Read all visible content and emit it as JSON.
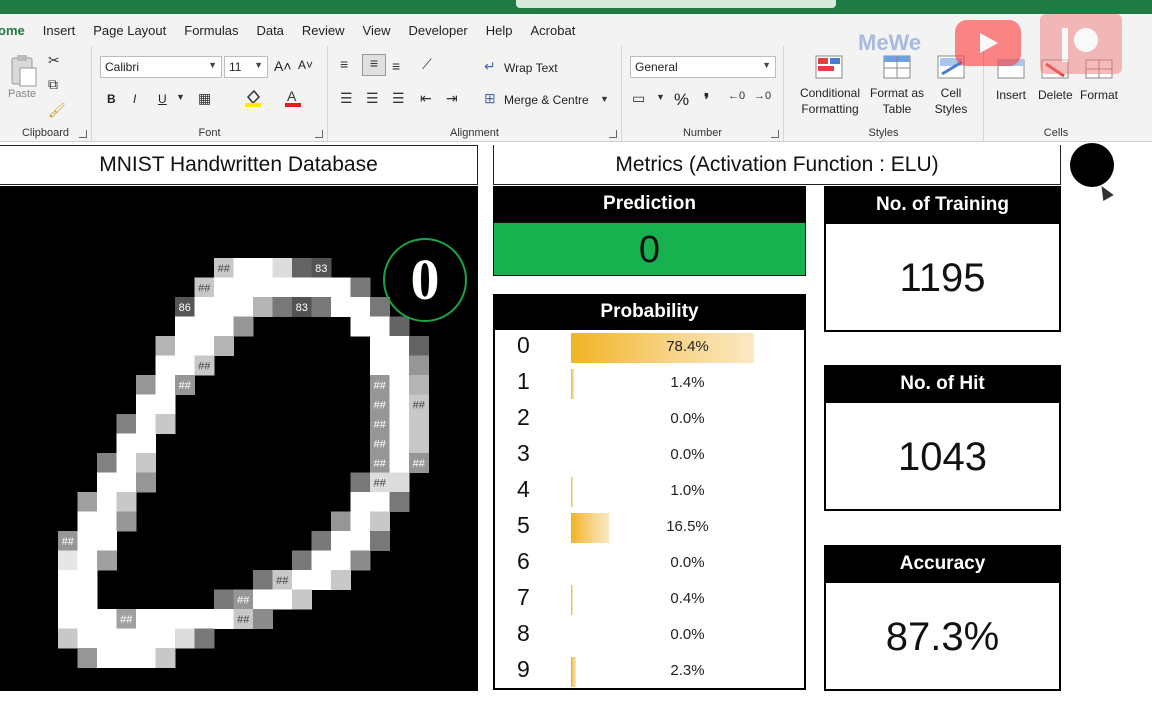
{
  "menu": {
    "tabs": [
      "ome",
      "Insert",
      "Page Layout",
      "Formulas",
      "Data",
      "Review",
      "View",
      "Developer",
      "Help",
      "Acrobat"
    ]
  },
  "watermarks": {
    "mewe": "MeWe"
  },
  "ribbon": {
    "clipboard": {
      "label": "Clipboard",
      "paste": "Paste"
    },
    "font": {
      "label": "Font",
      "name": "Calibri",
      "size": "11",
      "bold": "B",
      "italic": "I",
      "underline": "U",
      "grow": "A˄",
      "shrink": "A˅"
    },
    "alignment": {
      "label": "Alignment",
      "wrap": "Wrap Text",
      "merge": "Merge & Centre"
    },
    "number": {
      "label": "Number",
      "format": "General",
      "percent": "%",
      "comma": "❜"
    },
    "styles": {
      "label": "Styles",
      "conditional": "Conditional",
      "conditional2": "Formatting",
      "format_table": "Format as",
      "format_table2": "Table",
      "cell_styles": "Cell",
      "cell_styles2": "Styles"
    },
    "cells": {
      "label": "Cells",
      "insert": "Insert",
      "delete": "Delete",
      "format": "Format"
    }
  },
  "dashboard": {
    "mnist_title": "MNIST Handwritten Database",
    "predicted_digit_badge": "0",
    "metrics_title": "Metrics (Activation Function : ELU)",
    "prediction_label": "Prediction",
    "prediction_value": "0",
    "probability_label": "Probability",
    "probabilities": [
      {
        "digit": "0",
        "pct": "78.4%",
        "value": 0.784
      },
      {
        "digit": "1",
        "pct": "1.4%",
        "value": 0.014
      },
      {
        "digit": "2",
        "pct": "0.0%",
        "value": 0.0
      },
      {
        "digit": "3",
        "pct": "0.0%",
        "value": 0.0
      },
      {
        "digit": "4",
        "pct": "1.0%",
        "value": 0.01
      },
      {
        "digit": "5",
        "pct": "16.5%",
        "value": 0.165
      },
      {
        "digit": "6",
        "pct": "0.0%",
        "value": 0.0
      },
      {
        "digit": "7",
        "pct": "0.4%",
        "value": 0.004
      },
      {
        "digit": "8",
        "pct": "0.0%",
        "value": 0.0
      },
      {
        "digit": "9",
        "pct": "2.3%",
        "value": 0.023
      }
    ],
    "training_label": "No. of Training",
    "training_value": "1195",
    "hit_label": "No. of Hit",
    "hit_value": "1043",
    "accuracy_label": "Accuracy",
    "accuracy_value": "87.3%"
  },
  "mnist_cells": [
    {
      "r": 0,
      "c": 8,
      "v": 200,
      "t": "##"
    },
    {
      "r": 0,
      "c": 9,
      "v": 255
    },
    {
      "r": 0,
      "c": 10,
      "v": 255
    },
    {
      "r": 0,
      "c": 11,
      "v": 220
    },
    {
      "r": 0,
      "c": 12,
      "v": 100
    },
    {
      "r": 0,
      "c": 13,
      "v": 83,
      "t": "83"
    },
    {
      "r": 1,
      "c": 7,
      "v": 200,
      "t": "##"
    },
    {
      "r": 1,
      "c": 8,
      "v": 255
    },
    {
      "r": 1,
      "c": 9,
      "v": 255
    },
    {
      "r": 1,
      "c": 10,
      "v": 255
    },
    {
      "r": 1,
      "c": 11,
      "v": 255
    },
    {
      "r": 1,
      "c": 12,
      "v": 255
    },
    {
      "r": 1,
      "c": 13,
      "v": 255
    },
    {
      "r": 1,
      "c": 14,
      "v": 255
    },
    {
      "r": 1,
      "c": 15,
      "v": 120
    },
    {
      "r": 2,
      "c": 6,
      "v": 86,
      "t": "86"
    },
    {
      "r": 2,
      "c": 7,
      "v": 255
    },
    {
      "r": 2,
      "c": 8,
      "v": 255
    },
    {
      "r": 2,
      "c": 9,
      "v": 255
    },
    {
      "r": 2,
      "c": 10,
      "v": 180
    },
    {
      "r": 2,
      "c": 11,
      "v": 120
    },
    {
      "r": 2,
      "c": 12,
      "v": 83,
      "t": "83"
    },
    {
      "r": 2,
      "c": 13,
      "v": 120
    },
    {
      "r": 2,
      "c": 14,
      "v": 255
    },
    {
      "r": 2,
      "c": 15,
      "v": 255
    },
    {
      "r": 2,
      "c": 16,
      "v": 120
    },
    {
      "r": 3,
      "c": 6,
      "v": 255
    },
    {
      "r": 3,
      "c": 7,
      "v": 255
    },
    {
      "r": 3,
      "c": 8,
      "v": 255
    },
    {
      "r": 3,
      "c": 9,
      "v": 150
    },
    {
      "r": 3,
      "c": 15,
      "v": 255
    },
    {
      "r": 3,
      "c": 16,
      "v": 255
    },
    {
      "r": 3,
      "c": 17,
      "v": 100
    },
    {
      "r": 4,
      "c": 5,
      "v": 180
    },
    {
      "r": 4,
      "c": 6,
      "v": 255
    },
    {
      "r": 4,
      "c": 7,
      "v": 255
    },
    {
      "r": 4,
      "c": 8,
      "v": 180
    },
    {
      "r": 4,
      "c": 16,
      "v": 255
    },
    {
      "r": 4,
      "c": 17,
      "v": 255
    },
    {
      "r": 4,
      "c": 18,
      "v": 100
    },
    {
      "r": 5,
      "c": 5,
      "v": 255
    },
    {
      "r": 5,
      "c": 6,
      "v": 255
    },
    {
      "r": 5,
      "c": 7,
      "v": 200,
      "t": "##"
    },
    {
      "r": 5,
      "c": 16,
      "v": 255
    },
    {
      "r": 5,
      "c": 17,
      "v": 255
    },
    {
      "r": 5,
      "c": 18,
      "v": 150
    },
    {
      "r": 6,
      "c": 4,
      "v": 150
    },
    {
      "r": 6,
      "c": 5,
      "v": 255
    },
    {
      "r": 6,
      "c": 6,
      "v": 150,
      "t": "##"
    },
    {
      "r": 6,
      "c": 16,
      "v": 150,
      "t": "##"
    },
    {
      "r": 6,
      "c": 17,
      "v": 255
    },
    {
      "r": 6,
      "c": 18,
      "v": 180
    },
    {
      "r": 7,
      "c": 4,
      "v": 255
    },
    {
      "r": 7,
      "c": 5,
      "v": 255
    },
    {
      "r": 7,
      "c": 16,
      "v": 150,
      "t": "##"
    },
    {
      "r": 7,
      "c": 17,
      "v": 255
    },
    {
      "r": 7,
      "c": 18,
      "v": 200,
      "t": "##"
    },
    {
      "r": 8,
      "c": 3,
      "v": 130
    },
    {
      "r": 8,
      "c": 4,
      "v": 255
    },
    {
      "r": 8,
      "c": 5,
      "v": 200
    },
    {
      "r": 8,
      "c": 16,
      "v": 150,
      "t": "##"
    },
    {
      "r": 8,
      "c": 17,
      "v": 255
    },
    {
      "r": 8,
      "c": 18,
      "v": 200
    },
    {
      "r": 9,
      "c": 3,
      "v": 255
    },
    {
      "r": 9,
      "c": 4,
      "v": 255
    },
    {
      "r": 9,
      "c": 16,
      "v": 150,
      "t": "##"
    },
    {
      "r": 9,
      "c": 17,
      "v": 255
    },
    {
      "r": 9,
      "c": 18,
      "v": 200
    },
    {
      "r": 10,
      "c": 2,
      "v": 130
    },
    {
      "r": 10,
      "c": 3,
      "v": 255
    },
    {
      "r": 10,
      "c": 4,
      "v": 200
    },
    {
      "r": 10,
      "c": 16,
      "v": 150,
      "t": "##"
    },
    {
      "r": 10,
      "c": 17,
      "v": 255
    },
    {
      "r": 10,
      "c": 18,
      "v": 150,
      "t": "##"
    },
    {
      "r": 11,
      "c": 2,
      "v": 255
    },
    {
      "r": 11,
      "c": 3,
      "v": 255
    },
    {
      "r": 11,
      "c": 4,
      "v": 150
    },
    {
      "r": 11,
      "c": 15,
      "v": 120
    },
    {
      "r": 11,
      "c": 16,
      "v": 220,
      "t": "##"
    },
    {
      "r": 11,
      "c": 17,
      "v": 220
    },
    {
      "r": 12,
      "c": 1,
      "v": 160
    },
    {
      "r": 12,
      "c": 2,
      "v": 255
    },
    {
      "r": 12,
      "c": 3,
      "v": 200
    },
    {
      "r": 12,
      "c": 15,
      "v": 255
    },
    {
      "r": 12,
      "c": 16,
      "v": 255
    },
    {
      "r": 12,
      "c": 17,
      "v": 120
    },
    {
      "r": 13,
      "c": 1,
      "v": 255
    },
    {
      "r": 13,
      "c": 2,
      "v": 255
    },
    {
      "r": 13,
      "c": 3,
      "v": 150
    },
    {
      "r": 13,
      "c": 14,
      "v": 150
    },
    {
      "r": 13,
      "c": 15,
      "v": 255
    },
    {
      "r": 13,
      "c": 16,
      "v": 200
    },
    {
      "r": 14,
      "c": 0,
      "v": 150,
      "t": "##"
    },
    {
      "r": 14,
      "c": 1,
      "v": 255
    },
    {
      "r": 14,
      "c": 2,
      "v": 255
    },
    {
      "r": 14,
      "c": 13,
      "v": 120
    },
    {
      "r": 14,
      "c": 14,
      "v": 255
    },
    {
      "r": 14,
      "c": 15,
      "v": 255
    },
    {
      "r": 14,
      "c": 16,
      "v": 120
    },
    {
      "r": 15,
      "c": 0,
      "v": 230
    },
    {
      "r": 15,
      "c": 1,
      "v": 255
    },
    {
      "r": 15,
      "c": 2,
      "v": 160
    },
    {
      "r": 15,
      "c": 12,
      "v": 120
    },
    {
      "r": 15,
      "c": 13,
      "v": 255
    },
    {
      "r": 15,
      "c": 14,
      "v": 255
    },
    {
      "r": 15,
      "c": 15,
      "v": 140
    },
    {
      "r": 16,
      "c": 0,
      "v": 255
    },
    {
      "r": 16,
      "c": 1,
      "v": 255
    },
    {
      "r": 16,
      "c": 10,
      "v": 120
    },
    {
      "r": 16,
      "c": 11,
      "v": 200,
      "t": "##"
    },
    {
      "r": 16,
      "c": 12,
      "v": 255
    },
    {
      "r": 16,
      "c": 13,
      "v": 255
    },
    {
      "r": 16,
      "c": 14,
      "v": 200
    },
    {
      "r": 17,
      "c": 0,
      "v": 255
    },
    {
      "r": 17,
      "c": 1,
      "v": 255
    },
    {
      "r": 17,
      "c": 8,
      "v": 120
    },
    {
      "r": 17,
      "c": 9,
      "v": 150,
      "t": "##"
    },
    {
      "r": 17,
      "c": 10,
      "v": 255
    },
    {
      "r": 17,
      "c": 11,
      "v": 255
    },
    {
      "r": 17,
      "c": 12,
      "v": 200
    },
    {
      "r": 18,
      "c": 0,
      "v": 255
    },
    {
      "r": 18,
      "c": 1,
      "v": 255
    },
    {
      "r": 18,
      "c": 2,
      "v": 255
    },
    {
      "r": 18,
      "c": 3,
      "v": 160,
      "t": "##"
    },
    {
      "r": 18,
      "c": 4,
      "v": 255
    },
    {
      "r": 18,
      "c": 5,
      "v": 255
    },
    {
      "r": 18,
      "c": 6,
      "v": 255
    },
    {
      "r": 18,
      "c": 7,
      "v": 255
    },
    {
      "r": 18,
      "c": 8,
      "v": 255
    },
    {
      "r": 18,
      "c": 9,
      "v": 200,
      "t": "##"
    },
    {
      "r": 18,
      "c": 10,
      "v": 140
    },
    {
      "r": 19,
      "c": 0,
      "v": 200
    },
    {
      "r": 19,
      "c": 1,
      "v": 255
    },
    {
      "r": 19,
      "c": 2,
      "v": 255
    },
    {
      "r": 19,
      "c": 3,
      "v": 255
    },
    {
      "r": 19,
      "c": 4,
      "v": 255
    },
    {
      "r": 19,
      "c": 5,
      "v": 255
    },
    {
      "r": 19,
      "c": 6,
      "v": 220
    },
    {
      "r": 19,
      "c": 7,
      "v": 120
    },
    {
      "r": 20,
      "c": 1,
      "v": 150
    },
    {
      "r": 20,
      "c": 2,
      "v": 255
    },
    {
      "r": 20,
      "c": 3,
      "v": 255
    },
    {
      "r": 20,
      "c": 4,
      "v": 255
    },
    {
      "r": 20,
      "c": 5,
      "v": 200
    }
  ],
  "colors": {
    "excel_green": "#1f7a43",
    "prediction_green": "#17b150",
    "badge_ring": "#1ba348",
    "bar_gold": "#f1b321"
  }
}
